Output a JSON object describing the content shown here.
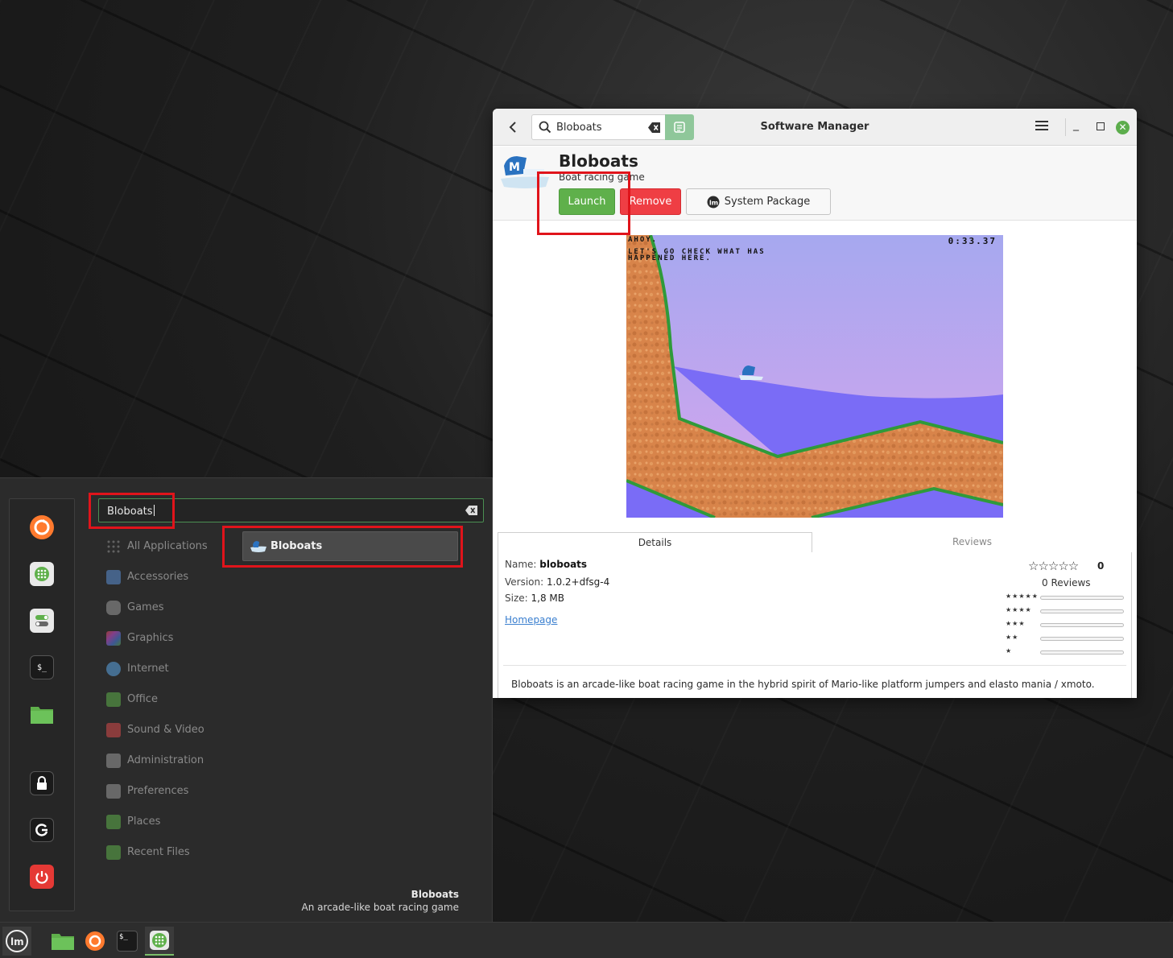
{
  "software_manager": {
    "title": "Software Manager",
    "search": {
      "value": "Bloboats"
    },
    "app": {
      "name": "Bloboats",
      "summary": "Boat racing game",
      "buttons": {
        "launch": "Launch",
        "remove": "Remove",
        "system_package": "System Package"
      }
    },
    "game_screenshot": {
      "line1": "AHOY.",
      "line2": "LET'S GO CHECK WHAT HAS",
      "line3": "HAPPENED HERE.",
      "timer": "0:33.37"
    },
    "tabs": {
      "details": "Details",
      "reviews": "Reviews"
    },
    "details": {
      "name_label": "Name:",
      "name_value": "bloboats",
      "version_label": "Version:",
      "version_value": "1.0.2+dfsg-4",
      "size_label": "Size:",
      "size_value": "1,8 MB",
      "homepage": "Homepage"
    },
    "rating": {
      "stars": "☆☆☆☆☆",
      "value": "0",
      "reviews": "0 Reviews",
      "histogram_labels": [
        "★★★★★",
        "★★★★",
        "★★★",
        "★★",
        "★"
      ]
    },
    "description": "Bloboats is an arcade-like boat racing game in the hybrid spirit of Mario-like platform jumpers and elasto mania / xmoto."
  },
  "start_menu": {
    "search": {
      "value": "Bloboats"
    },
    "categories": [
      {
        "label": "All Applications",
        "icon": "grid-icon",
        "color": "#777777"
      },
      {
        "label": "Accessories",
        "icon": "scissors-icon",
        "color": "#5b8fd6"
      },
      {
        "label": "Games",
        "icon": "gamepad-icon",
        "color": "#9a9a9a"
      },
      {
        "label": "Graphics",
        "icon": "palette-icon",
        "color": "#c94fd6"
      },
      {
        "label": "Internet",
        "icon": "cloud-icon",
        "color": "#5ba5e6"
      },
      {
        "label": "Office",
        "icon": "office-icon",
        "color": "#5fb04b"
      },
      {
        "label": "Sound & Video",
        "icon": "play-icon",
        "color": "#d94a4a"
      },
      {
        "label": "Administration",
        "icon": "admin-icon",
        "color": "#9a9a9a"
      },
      {
        "label": "Preferences",
        "icon": "preferences-icon",
        "color": "#9a9a9a"
      },
      {
        "label": "Places",
        "icon": "folder-icon",
        "color": "#5fb04b"
      },
      {
        "label": "Recent Files",
        "icon": "recent-folder-icon",
        "color": "#5fb04b"
      }
    ],
    "result": {
      "label": "Bloboats"
    },
    "footer": {
      "name": "Bloboats",
      "description": "An arcade-like boat racing game"
    },
    "favorites": [
      "firefox-icon",
      "software-manager-icon",
      "settings-icon",
      "terminal-icon",
      "files-icon",
      "lock-icon",
      "logout-icon",
      "power-icon"
    ]
  },
  "taskbar": {
    "items": [
      "mint-menu-icon",
      "files-icon",
      "firefox-icon",
      "terminal-icon",
      "software-manager-icon"
    ],
    "accent": "#7bbf6a"
  }
}
